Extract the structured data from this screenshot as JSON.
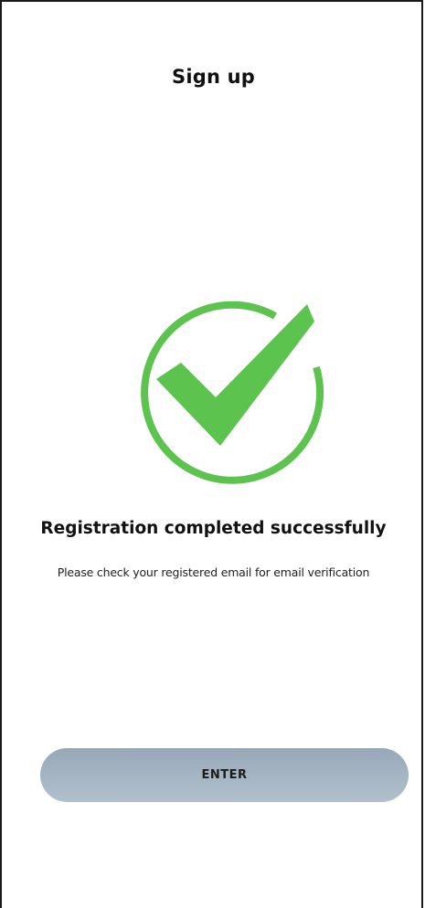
{
  "header": {
    "title": "Sign up"
  },
  "success": {
    "icon": "check-circle-icon",
    "icon_color": "#5cc34f",
    "title": "Registration completed successfully",
    "message": "Please check your registered email for email verification"
  },
  "actions": {
    "enter_label": "ENTER",
    "enter_gradient_top": "#97a8b8",
    "enter_gradient_bottom": "#b1c0cc"
  }
}
